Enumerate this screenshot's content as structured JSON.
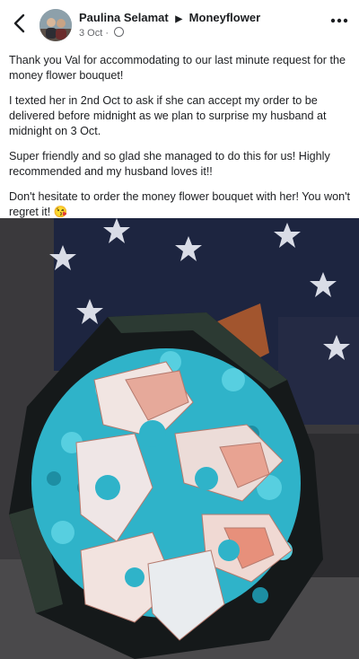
{
  "post": {
    "author": "Paulina Selamat",
    "page": "Moneyflower",
    "date": "3 Oct",
    "paragraphs": [
      "Thank you Val for accommodating to our last minute request for the money flower bouquet!",
      "I texted her in 2nd Oct to ask if she can accept my order to be delivered before midnight as we plan to surprise my husband at midnight on 3 Oct.",
      "Super friendly and so glad she managed to do this for us!  Highly recommended and my husband loves it!!",
      "Don't hesitate to order the money flower bouquet with her!  You won't regret it! 😘"
    ]
  },
  "icons": {
    "back": "back-arrow-icon",
    "audience": "globe-icon",
    "more": "more-options-icon",
    "arrow": "right-triangle-icon"
  },
  "colors": {
    "text": "#1c1e21",
    "meta": "#65676b",
    "flowers": "#2fb3c9"
  }
}
